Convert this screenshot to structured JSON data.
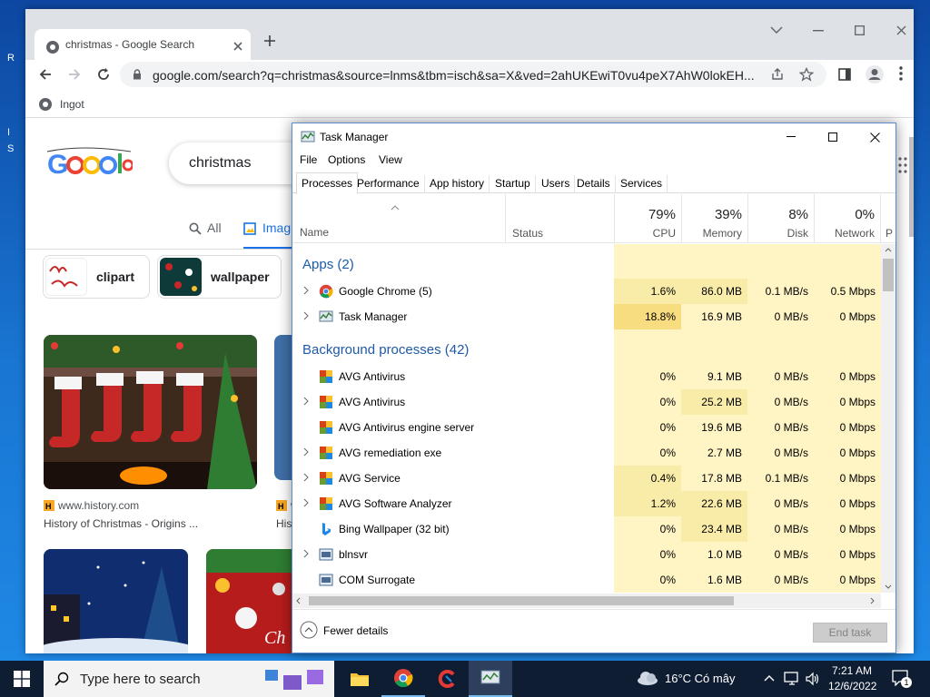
{
  "desktop": {
    "fragments": [
      "R",
      "I",
      "S"
    ]
  },
  "chrome": {
    "tab_title": "christmas - Google Search",
    "url": "google.com/search?q=christmas&source=lnms&tbm=isch&sa=X&ved=2ahUKEwiT0vu4peX7AhW0lokEH...",
    "bookmark": "Ingot",
    "search_query": "christmas",
    "nav_tabs": [
      "All",
      "Imag"
    ],
    "chips": [
      "clipart",
      "wallpaper"
    ],
    "results": [
      {
        "site": "www.history.com",
        "title": "History of Christmas - Origins ..."
      },
      {
        "site": "w",
        "title": "His"
      }
    ]
  },
  "taskmanager": {
    "title": "Task Manager",
    "menu": [
      "File",
      "Options",
      "View"
    ],
    "tabs": [
      "Processes",
      "Performance",
      "App history",
      "Startup",
      "Users",
      "Details",
      "Services"
    ],
    "columns": {
      "name": "Name",
      "status": "Status",
      "cpu": {
        "pct": "79%",
        "label": "CPU"
      },
      "memory": {
        "pct": "39%",
        "label": "Memory"
      },
      "disk": {
        "pct": "8%",
        "label": "Disk"
      },
      "network": {
        "pct": "0%",
        "label": "Network"
      },
      "extra": "P"
    },
    "groups": {
      "apps": "Apps (2)",
      "background": "Background processes (42)"
    },
    "apps": [
      {
        "name": "Google Chrome (5)",
        "cpu": "1.6%",
        "memory": "86.0 MB",
        "disk": "0.1 MB/s",
        "network": "0.5 Mbps",
        "icon": "chrome-icon"
      },
      {
        "name": "Task Manager",
        "cpu": "18.8%",
        "memory": "16.9 MB",
        "disk": "0 MB/s",
        "network": "0 Mbps",
        "icon": "taskmanager-icon"
      }
    ],
    "background": [
      {
        "name": "AVG Antivirus",
        "cpu": "0%",
        "memory": "9.1 MB",
        "disk": "0 MB/s",
        "network": "0 Mbps",
        "icon": "avg-icon",
        "expandable": false
      },
      {
        "name": "AVG Antivirus",
        "cpu": "0%",
        "memory": "25.2 MB",
        "disk": "0 MB/s",
        "network": "0 Mbps",
        "icon": "avg-icon",
        "expandable": true
      },
      {
        "name": "AVG Antivirus engine server",
        "cpu": "0%",
        "memory": "19.6 MB",
        "disk": "0 MB/s",
        "network": "0 Mbps",
        "icon": "avg-icon",
        "expandable": false
      },
      {
        "name": "AVG remediation exe",
        "cpu": "0%",
        "memory": "2.7 MB",
        "disk": "0 MB/s",
        "network": "0 Mbps",
        "icon": "avg-icon",
        "expandable": true
      },
      {
        "name": "AVG Service",
        "cpu": "0.4%",
        "memory": "17.8 MB",
        "disk": "0.1 MB/s",
        "network": "0 Mbps",
        "icon": "avg-icon",
        "expandable": true
      },
      {
        "name": "AVG Software Analyzer",
        "cpu": "1.2%",
        "memory": "22.6 MB",
        "disk": "0 MB/s",
        "network": "0 Mbps",
        "icon": "avg-icon",
        "expandable": true
      },
      {
        "name": "Bing Wallpaper (32 bit)",
        "cpu": "0%",
        "memory": "23.4 MB",
        "disk": "0 MB/s",
        "network": "0 Mbps",
        "icon": "bing-icon",
        "expandable": false
      },
      {
        "name": "blnsvr",
        "cpu": "0%",
        "memory": "1.0 MB",
        "disk": "0 MB/s",
        "network": "0 Mbps",
        "icon": "service-icon",
        "expandable": true
      },
      {
        "name": "COM Surrogate",
        "cpu": "0%",
        "memory": "1.6 MB",
        "disk": "0 MB/s",
        "network": "0 Mbps",
        "icon": "service-icon",
        "expandable": false
      }
    ],
    "fewer_details": "Fewer details",
    "end_task": "End task"
  },
  "taskbar": {
    "search_placeholder": "Type here to search",
    "weather": "16°C  Có mây",
    "time": "7:21 AM",
    "date": "12/6/2022",
    "notification_count": "1"
  },
  "colors": {
    "heat_low": "#fff4c4",
    "heat_mid": "#f9eca8",
    "heat_high": "#f7dd7f",
    "accent": "#1e5aa8"
  }
}
